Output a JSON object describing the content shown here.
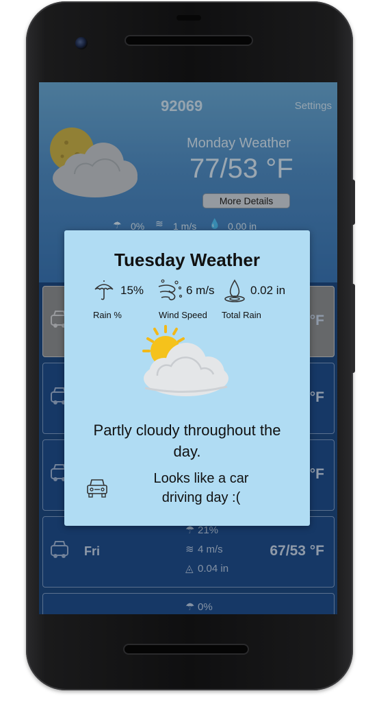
{
  "header": {
    "zip": "92069",
    "settings_label": "Settings",
    "day_title": "Monday Weather",
    "temperature": "77/53 °F",
    "more_details_label": "More Details",
    "stats": {
      "rain": "0%",
      "wind": "1 m/s",
      "total_rain": "0.00 in"
    }
  },
  "forecast": [
    {
      "day": "",
      "range": "°F",
      "selected": true
    },
    {
      "day": "",
      "range": "°F"
    },
    {
      "day": "",
      "range": "°F"
    },
    {
      "day": "Fri",
      "rain": "21%",
      "wind": "4 m/s",
      "total_rain": "0.04 in",
      "range": "67/53 °F"
    },
    {
      "day": "",
      "rain": "0%"
    }
  ],
  "modal": {
    "title": "Tuesday Weather",
    "rain_value": "15%",
    "rain_label": "Rain %",
    "wind_value": "6 m/s",
    "wind_label": "Wind Speed",
    "total_rain_value": "0.02 in",
    "total_rain_label": "Total Rain",
    "description": "Partly cloudy throughout the day.",
    "message": "Looks like a car driving day :("
  },
  "colors": {
    "modal_bg": "#b0dcf3",
    "screen_bg": "#1e4a83",
    "card_bg": "#1f4e8e",
    "sun": "#f5c21b",
    "cloud": "#e4e6e8"
  },
  "icons": {
    "weather": "sun-cloud-icon",
    "umbrella": "umbrella-icon",
    "wind": "wind-icon",
    "drop": "water-drop-icon",
    "car": "car-icon"
  }
}
